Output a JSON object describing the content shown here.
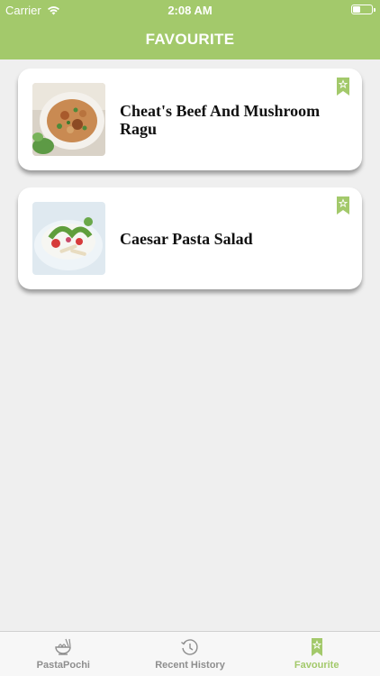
{
  "status_bar": {
    "carrier": "Carrier",
    "time": "2:08 AM",
    "icons": [
      "wifi-icon",
      "battery-icon"
    ]
  },
  "nav": {
    "title": "FAVOURITE"
  },
  "favourites": [
    {
      "name": "Cheat's Beef And Mushroom Ragu",
      "bookmark_icon": "bookmark-star-icon"
    },
    {
      "name": "Caesar Pasta Salad",
      "bookmark_icon": "bookmark-star-icon"
    }
  ],
  "tabs": [
    {
      "label": "PastaPochi",
      "icon": "pasta-bowl-icon",
      "active": false
    },
    {
      "label": "Recent History",
      "icon": "history-clock-icon",
      "active": false
    },
    {
      "label": "Favourite",
      "icon": "bookmark-star-icon",
      "active": true
    }
  ],
  "colors": {
    "accent": "#a3c96b",
    "background": "#efefef",
    "tab_inactive": "#8e8e8e"
  }
}
